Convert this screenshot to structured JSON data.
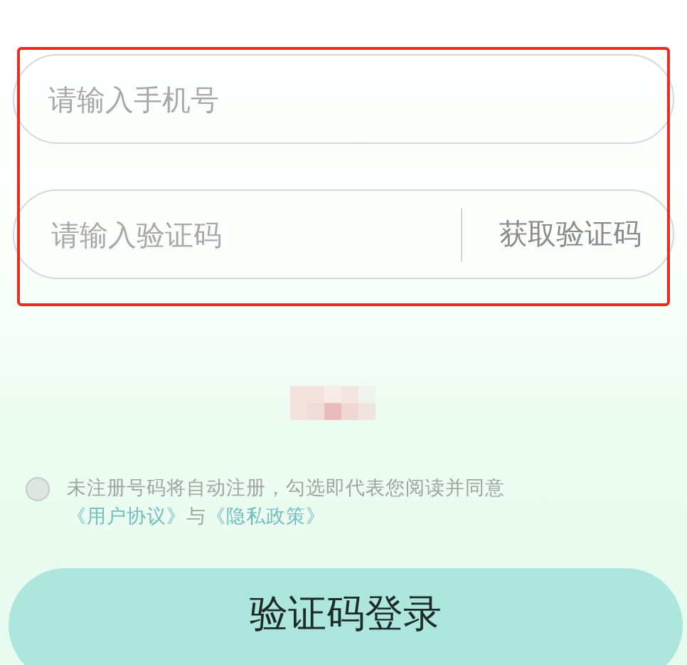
{
  "phone_field": {
    "placeholder": "请输入手机号"
  },
  "code_field": {
    "placeholder": "请输入验证码",
    "get_code_button": "获取验证码"
  },
  "highlight": {
    "shown": true
  },
  "agreement": {
    "checked": false,
    "text": "未注册号码将自动注册，勾选即代表您阅读并同意",
    "links": [
      {
        "label": "《用户协议》"
      },
      {
        "label": "《隐私政策》"
      }
    ],
    "joiner": "与"
  },
  "login_button": {
    "label": "验证码登录"
  }
}
